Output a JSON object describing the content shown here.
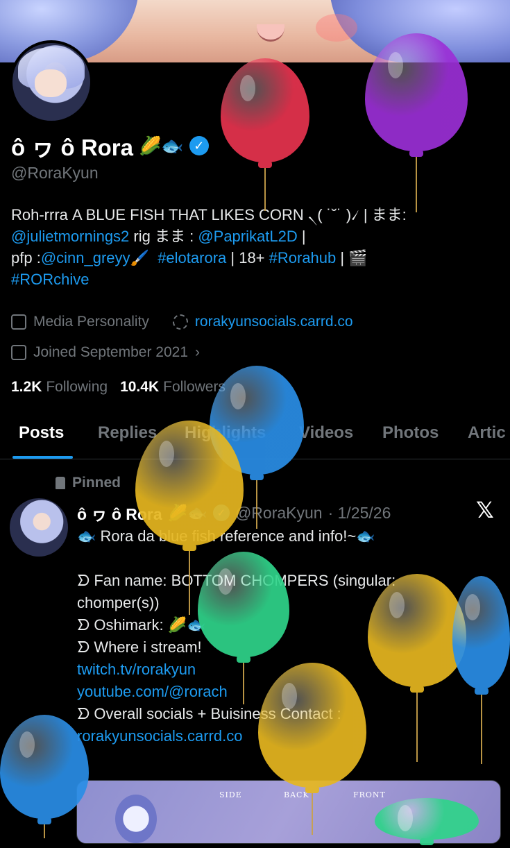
{
  "profile": {
    "display_name": "ô ヮ ô Rora",
    "emojis": "🌽🐟",
    "verified_mark": "✓",
    "handle": "@RoraKyun",
    "bio_line1_text": "Roh-rrrа A BLUE FISH THAT LIKES CORN ৲( ˙˘˙ )৴ | まま:",
    "bio_line2_link1": "@julietmornings2",
    "bio_line2_text": " rig まま : ",
    "bio_line2_link2": "@PaprikatL2D",
    "bio_line2_tail": " |",
    "bio_line3_text1": "pfp :",
    "bio_line3_link1": "@cinn_greyy",
    "bio_line3_brush": "🖌️",
    "bio_line3_link2": "#elotarora",
    "bio_line3_text2": " | 18+ ",
    "bio_line3_link3": "#Rorahub",
    "bio_line3_text3": " | 🎬",
    "bio_line4_link": "#RORchive",
    "category": "Media Personality",
    "website": "rorakyunsocials.carrd.co",
    "joined": "Joined September 2021",
    "joined_chevron": "›",
    "following_count": "1.2K",
    "following_label": "Following",
    "followers_count": "10.4K",
    "followers_label": "Followers"
  },
  "tabs": [
    "Posts",
    "Replies",
    "Highlights",
    "Videos",
    "Photos",
    "Artic"
  ],
  "pinned_post": {
    "pinned_label": "Pinned",
    "author_name": "ô ヮ ô Rora",
    "author_emojis": "🌽🐟",
    "author_handle": "@RoraKyun",
    "date": "· 1/25/26",
    "x_logo": "𝕏",
    "title": "🐟 Rora da blue fish reference and info!~🐟",
    "fan_name_line1": "ᗤ Fan name: BOTTOM CHOMPERS (singular:",
    "fan_name_line2": "chomper(s))",
    "oshimark": "ᗤ  Oshimark: 🌽🐟",
    "where_stream": "ᗤ  Where i stream!",
    "link_twitch": "twitch.tv/rorakyun",
    "link_youtube": "youtube.com/@rorach",
    "socials": "ᗤ Overall socials + Buisiness Contact :",
    "link_carrd": "rorakyunsocials.carrd.co",
    "preview_labels": [
      "SIDE",
      "BACK",
      "FRONT"
    ]
  },
  "colors": {
    "accent": "#1d9bf0",
    "balloon_red": "#e8334f",
    "balloon_purple": "#9b2fd6",
    "balloon_blue": "#2a8ee6",
    "balloon_yellow": "#e6b720",
    "balloon_green": "#2fd48a"
  }
}
